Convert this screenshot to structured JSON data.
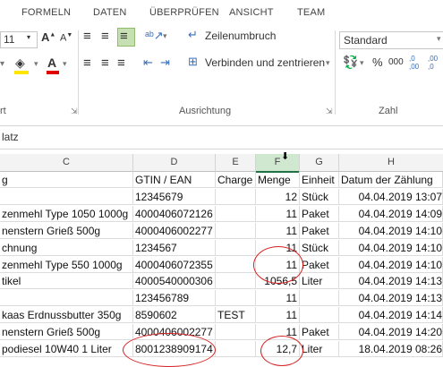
{
  "tabs": [
    "FORMELN",
    "DATEN",
    "ÜBERPRÜFEN",
    "ANSICHT",
    "TEAM"
  ],
  "ribbon": {
    "font_size": "11",
    "grow_font": "A",
    "shrink_font": "A",
    "wrap_text": "Zeilenumbruch",
    "merge_center": "Verbinden und zentrieren",
    "number_format": "Standard",
    "percent": "%",
    "thousands": "000",
    "dec_inc": ",0 ,00",
    "dec_dec": ",00 ,0",
    "group_alignment": "Ausrichtung",
    "group_number": "Zahl",
    "group_font_partial": "rt"
  },
  "formula_bar": {
    "name_box_partial": "latz"
  },
  "columns": [
    "C",
    "D",
    "E",
    "F",
    "G",
    "H"
  ],
  "header_row": [
    "g",
    "GTIN / EAN",
    "Charge",
    "Menge",
    "Einheit",
    "Datum der Zählung"
  ],
  "rows": [
    [
      "",
      "12345679",
      "",
      "12",
      "Stück",
      "04.04.2019 13:07"
    ],
    [
      "zenmehl Type 1050 1000g",
      "4000406072126",
      "",
      "11",
      "Paket",
      "04.04.2019 14:09"
    ],
    [
      "nenstern Grieß 500g",
      "4000406002277",
      "",
      "11",
      "Paket",
      "04.04.2019 14:10"
    ],
    [
      "chnung",
      "1234567",
      "",
      "11",
      "Stück",
      "04.04.2019 14:10"
    ],
    [
      "zenmehl Type 550 1000g",
      "4000406072355",
      "",
      "11",
      "Paket",
      "04.04.2019 14:10"
    ],
    [
      "tikel",
      "4000540000306",
      "",
      "1056,5",
      "Liter",
      "04.04.2019 14:13"
    ],
    [
      "",
      "123456789",
      "",
      "11",
      "",
      "04.04.2019 14:13"
    ],
    [
      "kaas Erdnussbutter 350g",
      "8590602",
      "TEST",
      "11",
      "",
      "04.04.2019 14:14"
    ],
    [
      "nenstern Grieß 500g",
      "4000406002277",
      "",
      "11",
      "Paket",
      "04.04.2019 14:20"
    ],
    [
      "podiesel 10W40 1 Liter",
      "8001238909174",
      "",
      "12,7",
      "Liter",
      "18.04.2019 08:26"
    ]
  ],
  "accent": "#217346",
  "highlight_color": "#d62020"
}
